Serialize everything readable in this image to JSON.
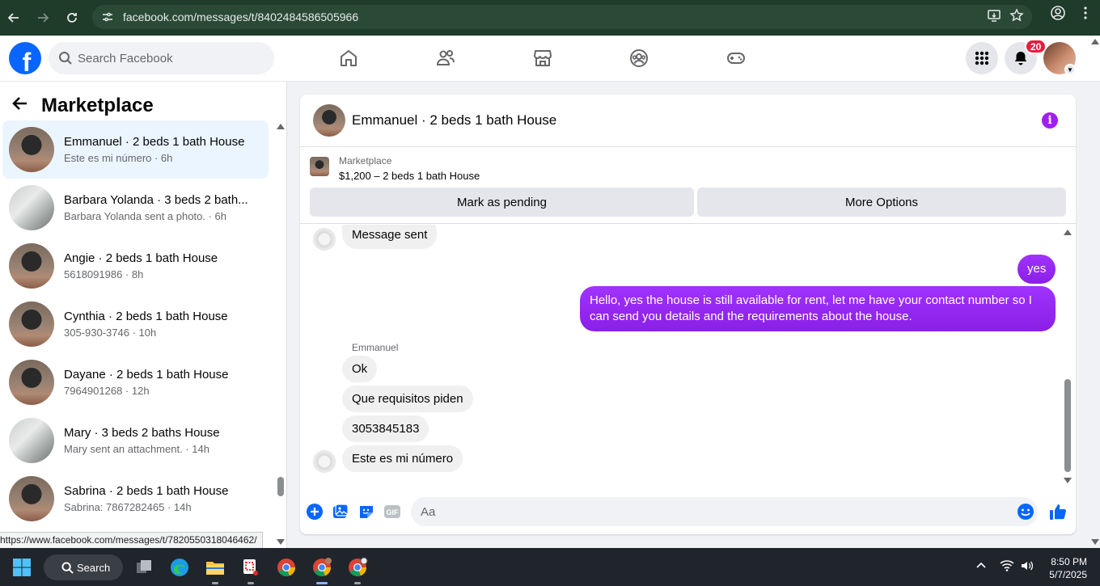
{
  "browser": {
    "url": "facebook.com/messages/t/8402484586505966",
    "status_url": "https://www.facebook.com/messages/t/7820550318046462/"
  },
  "header": {
    "search_placeholder": "Search Facebook",
    "notification_count": "20",
    "nav_icons": [
      "home-icon",
      "friends-icon",
      "marketplace-icon",
      "groups-icon",
      "gaming-icon"
    ]
  },
  "sidebar": {
    "title": "Marketplace",
    "conversations": [
      {
        "name": "Emmanuel · 2 beds 1 bath House",
        "preview": "Este es mi número · 6h",
        "thumb": "house",
        "active": true
      },
      {
        "name": "Barbara Yolanda · 3 beds 2 bath...",
        "preview": "Barbara Yolanda sent a photo. · 6h",
        "thumb": "bath",
        "active": false
      },
      {
        "name": "Angie · 2 beds 1 bath House",
        "preview": "5618091986 · 8h",
        "thumb": "house",
        "active": false
      },
      {
        "name": "Cynthia · 2 beds 1 bath House",
        "preview": "305-930-3746 · 10h",
        "thumb": "house",
        "active": false
      },
      {
        "name": "Dayane · 2 beds 1 bath House",
        "preview": "7964901268 · 12h",
        "thumb": "house",
        "active": false
      },
      {
        "name": "Mary · 3 beds 2 baths House",
        "preview": "Mary sent an attachment. · 14h",
        "thumb": "bath",
        "active": false
      },
      {
        "name": "Sabrina · 2 beds 1 bath House",
        "preview": "Sabrina: 7867282465 · 14h",
        "thumb": "house",
        "active": false
      }
    ]
  },
  "chat": {
    "title": "Emmanuel · 2 beds 1 bath House",
    "marketplace_label": "Marketplace",
    "listing": "$1,200 – 2 beds 1 bath House",
    "mark_pending": "Mark as pending",
    "more_options": "More Options",
    "messages": {
      "sent_status": "Message sent",
      "out_1": "yes",
      "out_2": "Hello, yes the house is still available for rent, let me have your contact number so I can send you details and the requirements about the house.",
      "sender_name": "Emmanuel",
      "in_1": "Ok",
      "in_2": "Que requisitos piden",
      "in_3": "3053845183",
      "in_4": "Este es mi número"
    },
    "composer_placeholder": "Aa"
  },
  "taskbar": {
    "search_label": "Search",
    "time": "8:50 PM",
    "date": "5/7/2025"
  },
  "colors": {
    "brand": "#0866ff",
    "outgoing_bubble": "#9b2cf5",
    "notification_badge": "#e41e3f"
  }
}
